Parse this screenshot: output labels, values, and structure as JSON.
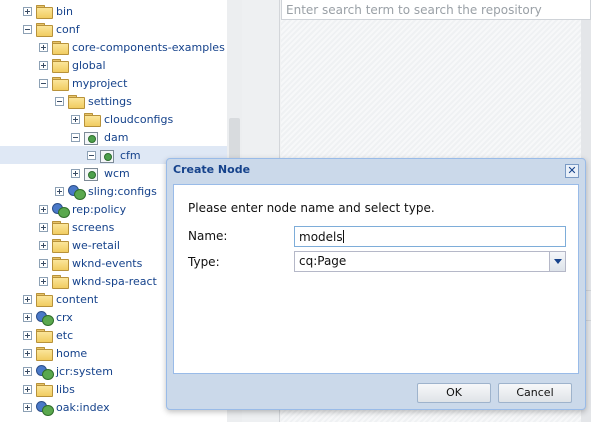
{
  "tree": {
    "items": [
      {
        "label": "bin",
        "icon": "folder-icon",
        "toggle": "plus"
      },
      {
        "label": "conf",
        "icon": "folder-icon",
        "toggle": "minus"
      },
      {
        "label": "core-components-examples",
        "icon": "folder-icon",
        "toggle": "plus"
      },
      {
        "label": "global",
        "icon": "folder-icon",
        "toggle": "plus"
      },
      {
        "label": "myproject",
        "icon": "folder-icon",
        "toggle": "minus"
      },
      {
        "label": "settings",
        "icon": "folder-icon",
        "toggle": "minus"
      },
      {
        "label": "cloudconfigs",
        "icon": "folder-icon",
        "toggle": "plus"
      },
      {
        "label": "dam",
        "icon": "config-node-icon",
        "toggle": "minus"
      },
      {
        "label": "cfm",
        "icon": "config-node-icon",
        "toggle": "minus",
        "selected": true
      },
      {
        "label": "wcm",
        "icon": "config-node-icon",
        "toggle": "plus"
      },
      {
        "label": "sling:configs",
        "icon": "system-node-icon",
        "toggle": "plus"
      },
      {
        "label": "rep:policy",
        "icon": "system-node-icon",
        "toggle": "plus"
      },
      {
        "label": "screens",
        "icon": "folder-icon",
        "toggle": "plus"
      },
      {
        "label": "we-retail",
        "icon": "folder-icon",
        "toggle": "plus"
      },
      {
        "label": "wknd-events",
        "icon": "folder-icon",
        "toggle": "plus"
      },
      {
        "label": "wknd-spa-react",
        "icon": "folder-icon",
        "toggle": "plus"
      },
      {
        "label": "content",
        "icon": "folder-icon",
        "toggle": "plus"
      },
      {
        "label": "crx",
        "icon": "system-node-icon",
        "toggle": "plus"
      },
      {
        "label": "etc",
        "icon": "folder-icon",
        "toggle": "plus"
      },
      {
        "label": "home",
        "icon": "folder-icon",
        "toggle": "plus"
      },
      {
        "label": "jcr:system",
        "icon": "system-node-icon",
        "toggle": "plus"
      },
      {
        "label": "libs",
        "icon": "folder-icon",
        "toggle": "plus"
      },
      {
        "label": "oak:index",
        "icon": "system-node-icon",
        "toggle": "plus"
      }
    ]
  },
  "search": {
    "placeholder": "Enter search term to search the repository"
  },
  "dialog": {
    "title": "Create Node",
    "close_glyph": "✕",
    "message": "Please enter node name and select type.",
    "name_label": "Name:",
    "name_value": "models",
    "type_label": "Type:",
    "type_value": "cq:Page",
    "ok_label": "OK",
    "cancel_label": "Cancel"
  }
}
